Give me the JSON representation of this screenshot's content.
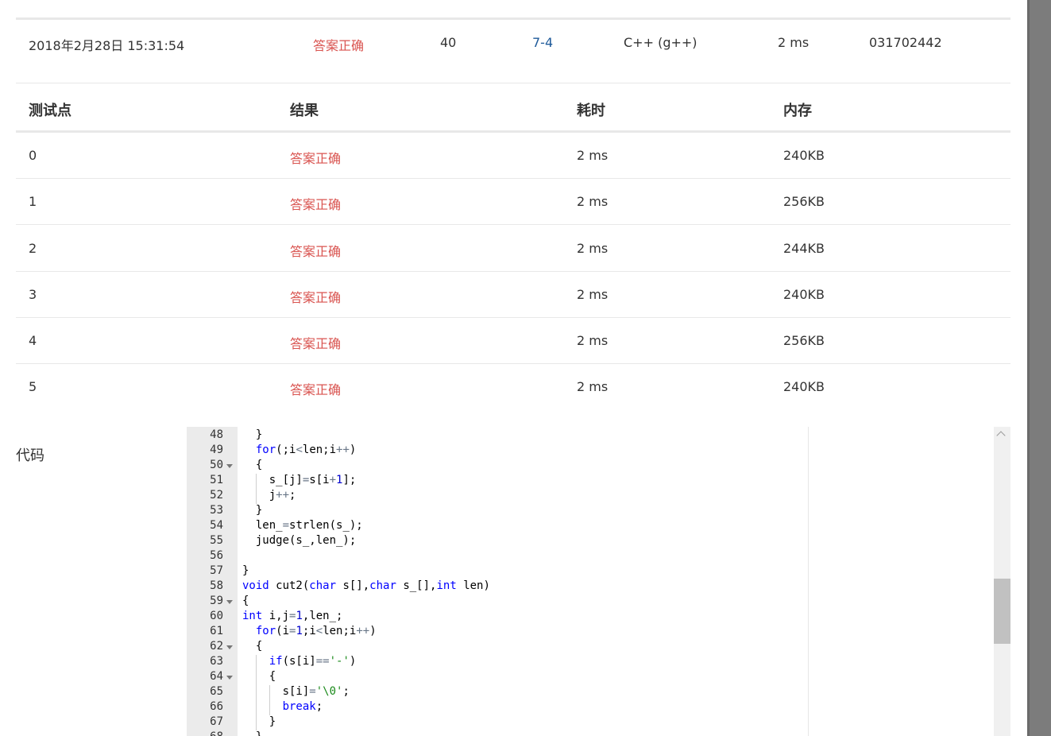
{
  "summary": {
    "time": "2018年2月28日 15:31:54",
    "status": "答案正确",
    "score": "40",
    "problem": "7-4",
    "compiler": "C++ (g++)",
    "runtime": "2 ms",
    "user": "031702442"
  },
  "results": {
    "headers": [
      "测试点",
      "结果",
      "耗时",
      "内存"
    ],
    "rows": [
      {
        "point": "0",
        "result": "答案正确",
        "time": "2 ms",
        "memory": "240KB"
      },
      {
        "point": "1",
        "result": "答案正确",
        "time": "2 ms",
        "memory": "256KB"
      },
      {
        "point": "2",
        "result": "答案正确",
        "time": "2 ms",
        "memory": "244KB"
      },
      {
        "point": "3",
        "result": "答案正确",
        "time": "2 ms",
        "memory": "240KB"
      },
      {
        "point": "4",
        "result": "答案正确",
        "time": "2 ms",
        "memory": "256KB"
      },
      {
        "point": "5",
        "result": "答案正确",
        "time": "2 ms",
        "memory": "240KB"
      }
    ]
  },
  "code": {
    "label": "代码",
    "lines": [
      {
        "n": "48",
        "fold": false,
        "text": "  }"
      },
      {
        "n": "49",
        "fold": false,
        "text": "  for(;i<len;i++)"
      },
      {
        "n": "50",
        "fold": true,
        "text": "  {"
      },
      {
        "n": "51",
        "fold": false,
        "text": "    s_[j]=s[i+1];"
      },
      {
        "n": "52",
        "fold": false,
        "text": "    j++;"
      },
      {
        "n": "53",
        "fold": false,
        "text": "  }"
      },
      {
        "n": "54",
        "fold": false,
        "text": "  len_=strlen(s_);"
      },
      {
        "n": "55",
        "fold": false,
        "text": "  judge(s_,len_);"
      },
      {
        "n": "56",
        "fold": false,
        "text": ""
      },
      {
        "n": "57",
        "fold": false,
        "text": "}"
      },
      {
        "n": "58",
        "fold": false,
        "text": "void cut2(char s[],char s_[],int len)"
      },
      {
        "n": "59",
        "fold": true,
        "text": "{"
      },
      {
        "n": "60",
        "fold": false,
        "text": "int i,j=1,len_;"
      },
      {
        "n": "61",
        "fold": false,
        "text": "  for(i=1;i<len;i++)"
      },
      {
        "n": "62",
        "fold": true,
        "text": "  {"
      },
      {
        "n": "63",
        "fold": false,
        "text": "    if(s[i]=='-')"
      },
      {
        "n": "64",
        "fold": true,
        "text": "    {"
      },
      {
        "n": "65",
        "fold": false,
        "text": "      s[i]='\\0';"
      },
      {
        "n": "66",
        "fold": false,
        "text": "      break;"
      },
      {
        "n": "67",
        "fold": false,
        "text": "    }"
      },
      {
        "n": "68",
        "fold": false,
        "text": "  }"
      }
    ]
  }
}
